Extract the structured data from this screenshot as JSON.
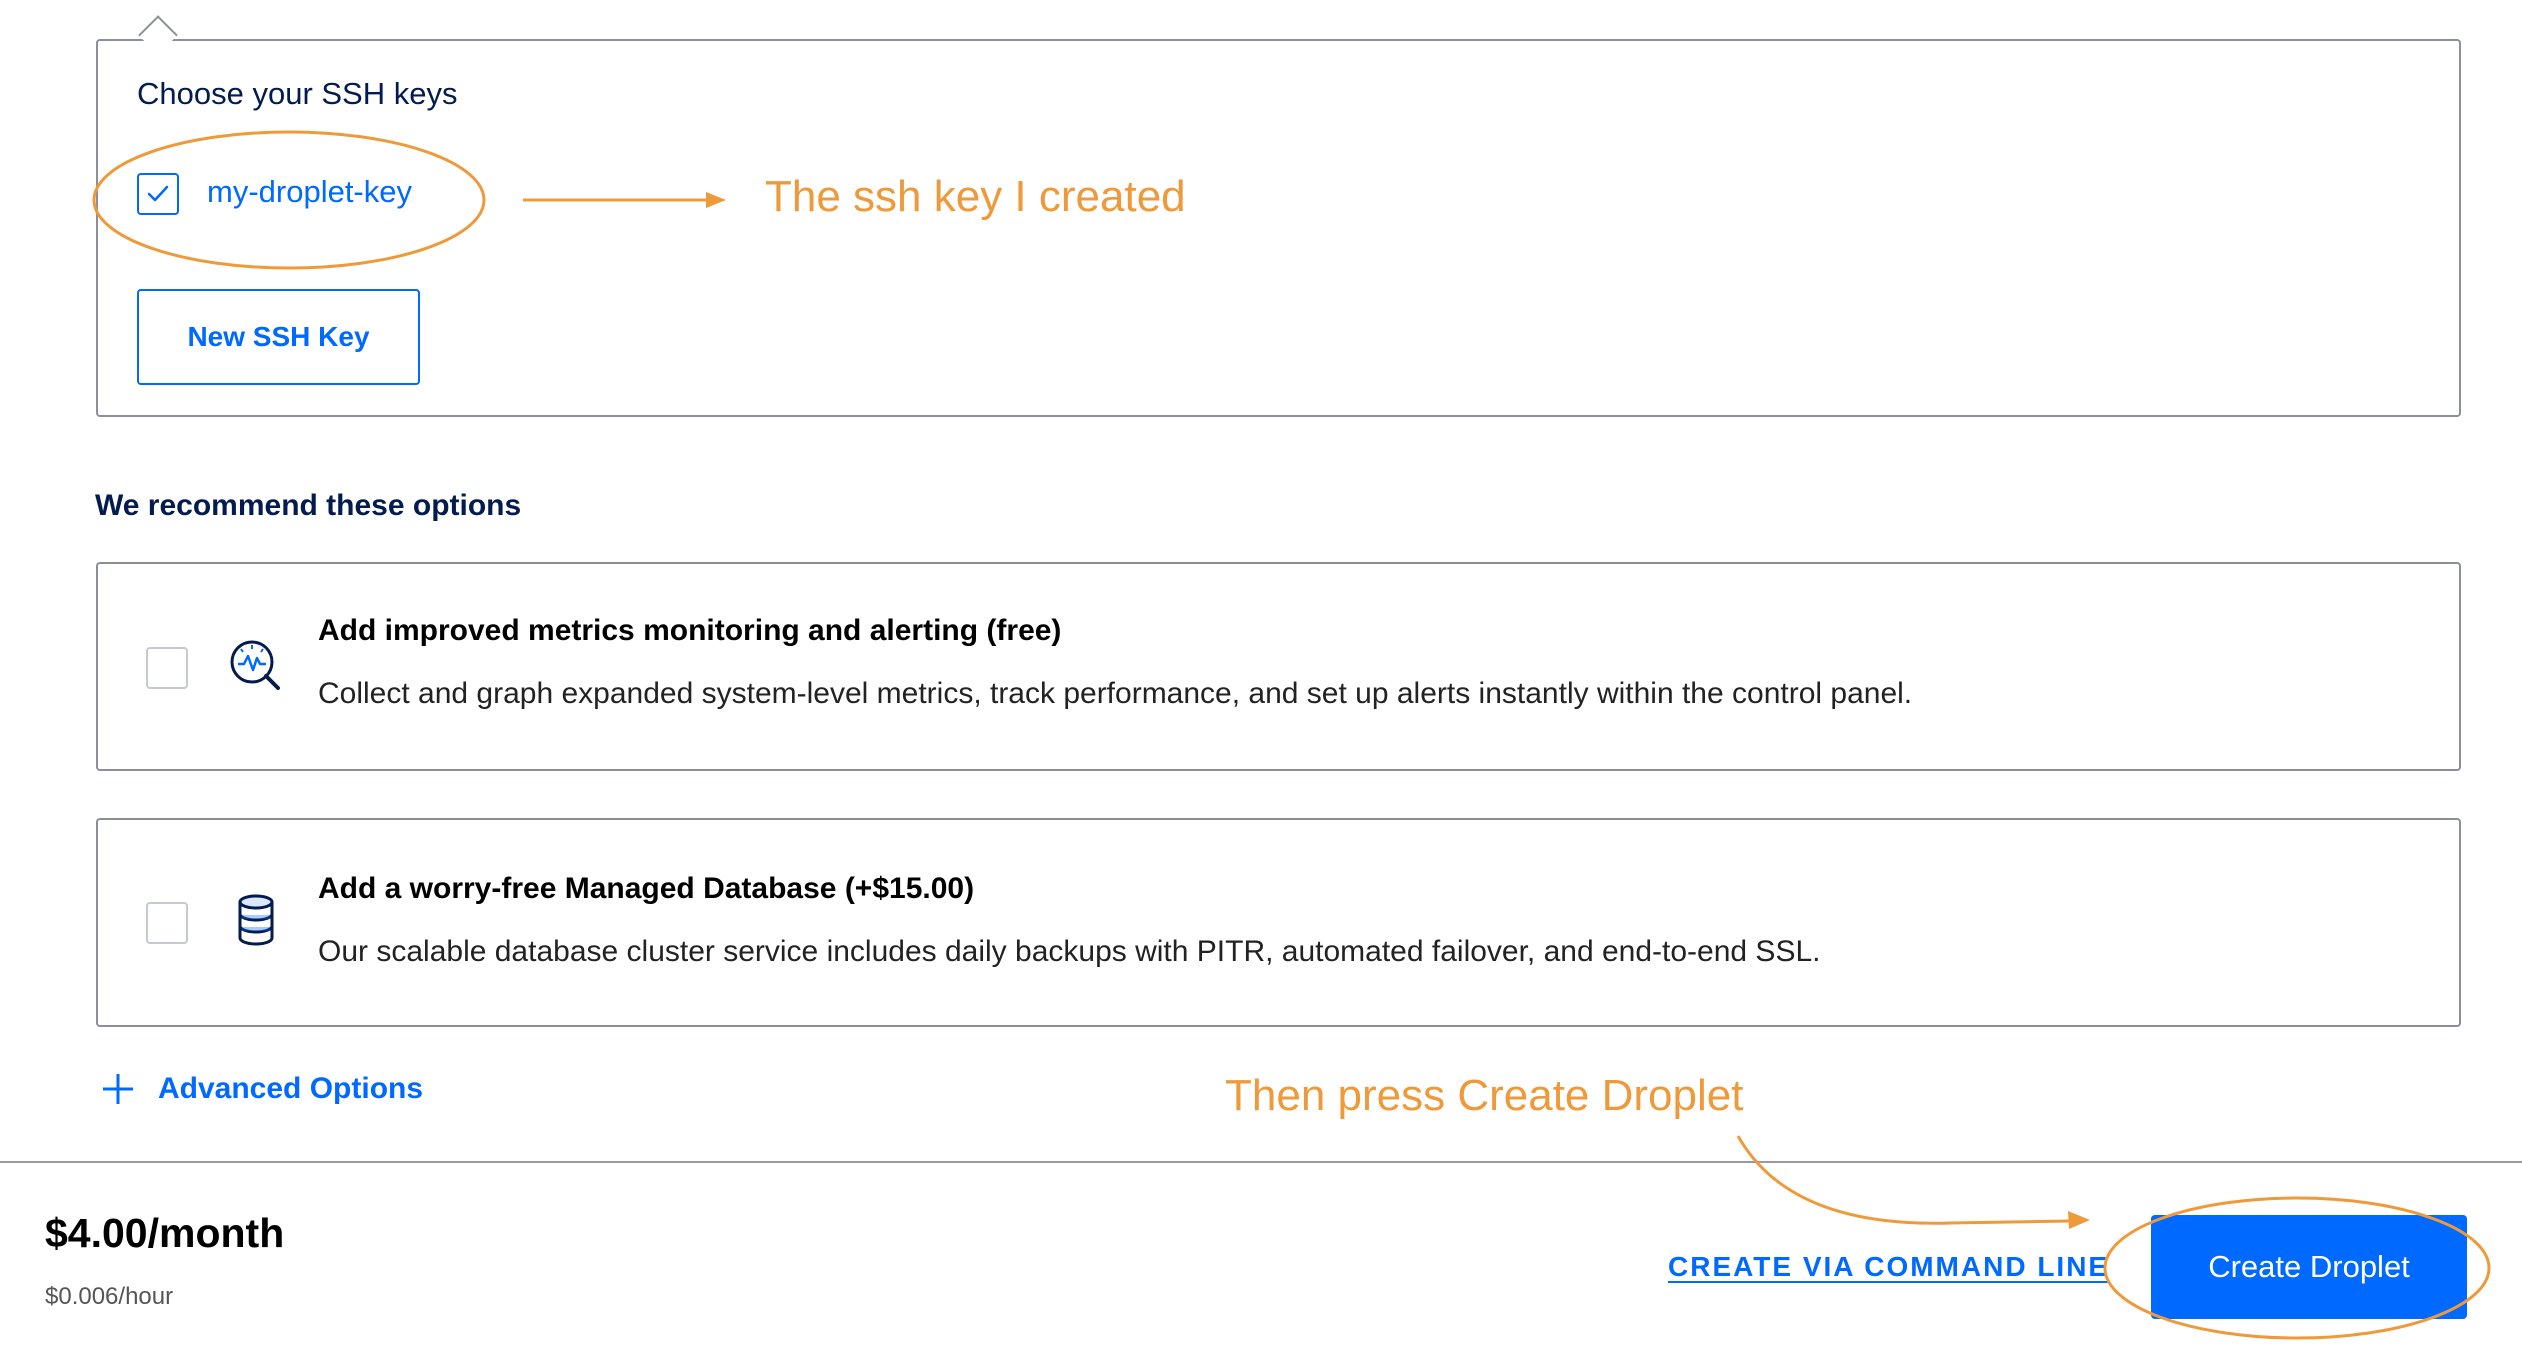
{
  "ssh_section": {
    "title": "Choose your SSH keys",
    "key_label": "my-droplet-key",
    "key_checked": true,
    "new_key_button": "New SSH Key"
  },
  "recommend": {
    "title": "We recommend these options",
    "options": [
      {
        "title": "Add improved metrics monitoring and alerting (free)",
        "description": "Collect and graph expanded system-level metrics, track performance, and set up alerts instantly within the control panel.",
        "icon": "metrics-icon",
        "checked": false
      },
      {
        "title": "Add a worry-free Managed Database (+$15.00)",
        "description": "Our scalable database cluster service includes daily backups with PITR, automated failover, and end-to-end SSL.",
        "icon": "database-icon",
        "checked": false
      }
    ]
  },
  "advanced": {
    "label": "Advanced Options",
    "icon": "plus-icon"
  },
  "footer": {
    "price_month": "$4.00/month",
    "price_hour": "$0.006/hour",
    "cli_link": "CREATE VIA COMMAND LINE",
    "create_button": "Create Droplet"
  },
  "annotations": {
    "ssh_note": "The ssh key I created",
    "create_note": "Then press Create Droplet",
    "color": "#ee9a3a"
  },
  "colors": {
    "accent": "#0069ff",
    "border": "#8c8f99",
    "heading": "#031b4e"
  }
}
